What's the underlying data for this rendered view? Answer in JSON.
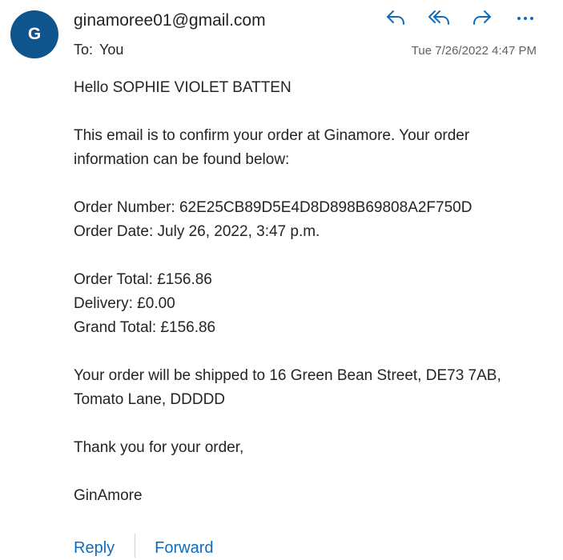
{
  "email": {
    "avatar_initial": "G",
    "sender": "ginamoree01@gmail.com",
    "to_label": "To:",
    "to_value": "You",
    "timestamp": "Tue 7/26/2022 4:47 PM"
  },
  "actions": {
    "icons": [
      "reply-icon",
      "reply-all-icon",
      "forward-icon",
      "more-options-icon"
    ]
  },
  "body": {
    "greeting": "Hello SOPHIE VIOLET BATTEN",
    "intro": "This email is to confirm your order at Ginamore. Your order information can be found below:",
    "order_number": "Order Number: 62E25CB89D5E4D8D898B69808A2F750D",
    "order_date": "Order Date: July 26, 2022, 3:47 p.m.",
    "order_total": "Order Total: £156.86",
    "delivery": "Delivery: £0.00",
    "grand_total": "Grand Total: £156.86",
    "shipping": "Your order will be shipped to 16 Green Bean Street, DE73 7AB, Tomato Lane, DDDDD",
    "thanks": "Thank you for your order,",
    "signature": "GinAmore"
  },
  "footer": {
    "reply_label": "Reply",
    "forward_label": "Forward"
  },
  "colors": {
    "avatar_bg": "#0f548c",
    "accent": "#0f6cbd",
    "text": "#242424",
    "muted": "#616161"
  }
}
